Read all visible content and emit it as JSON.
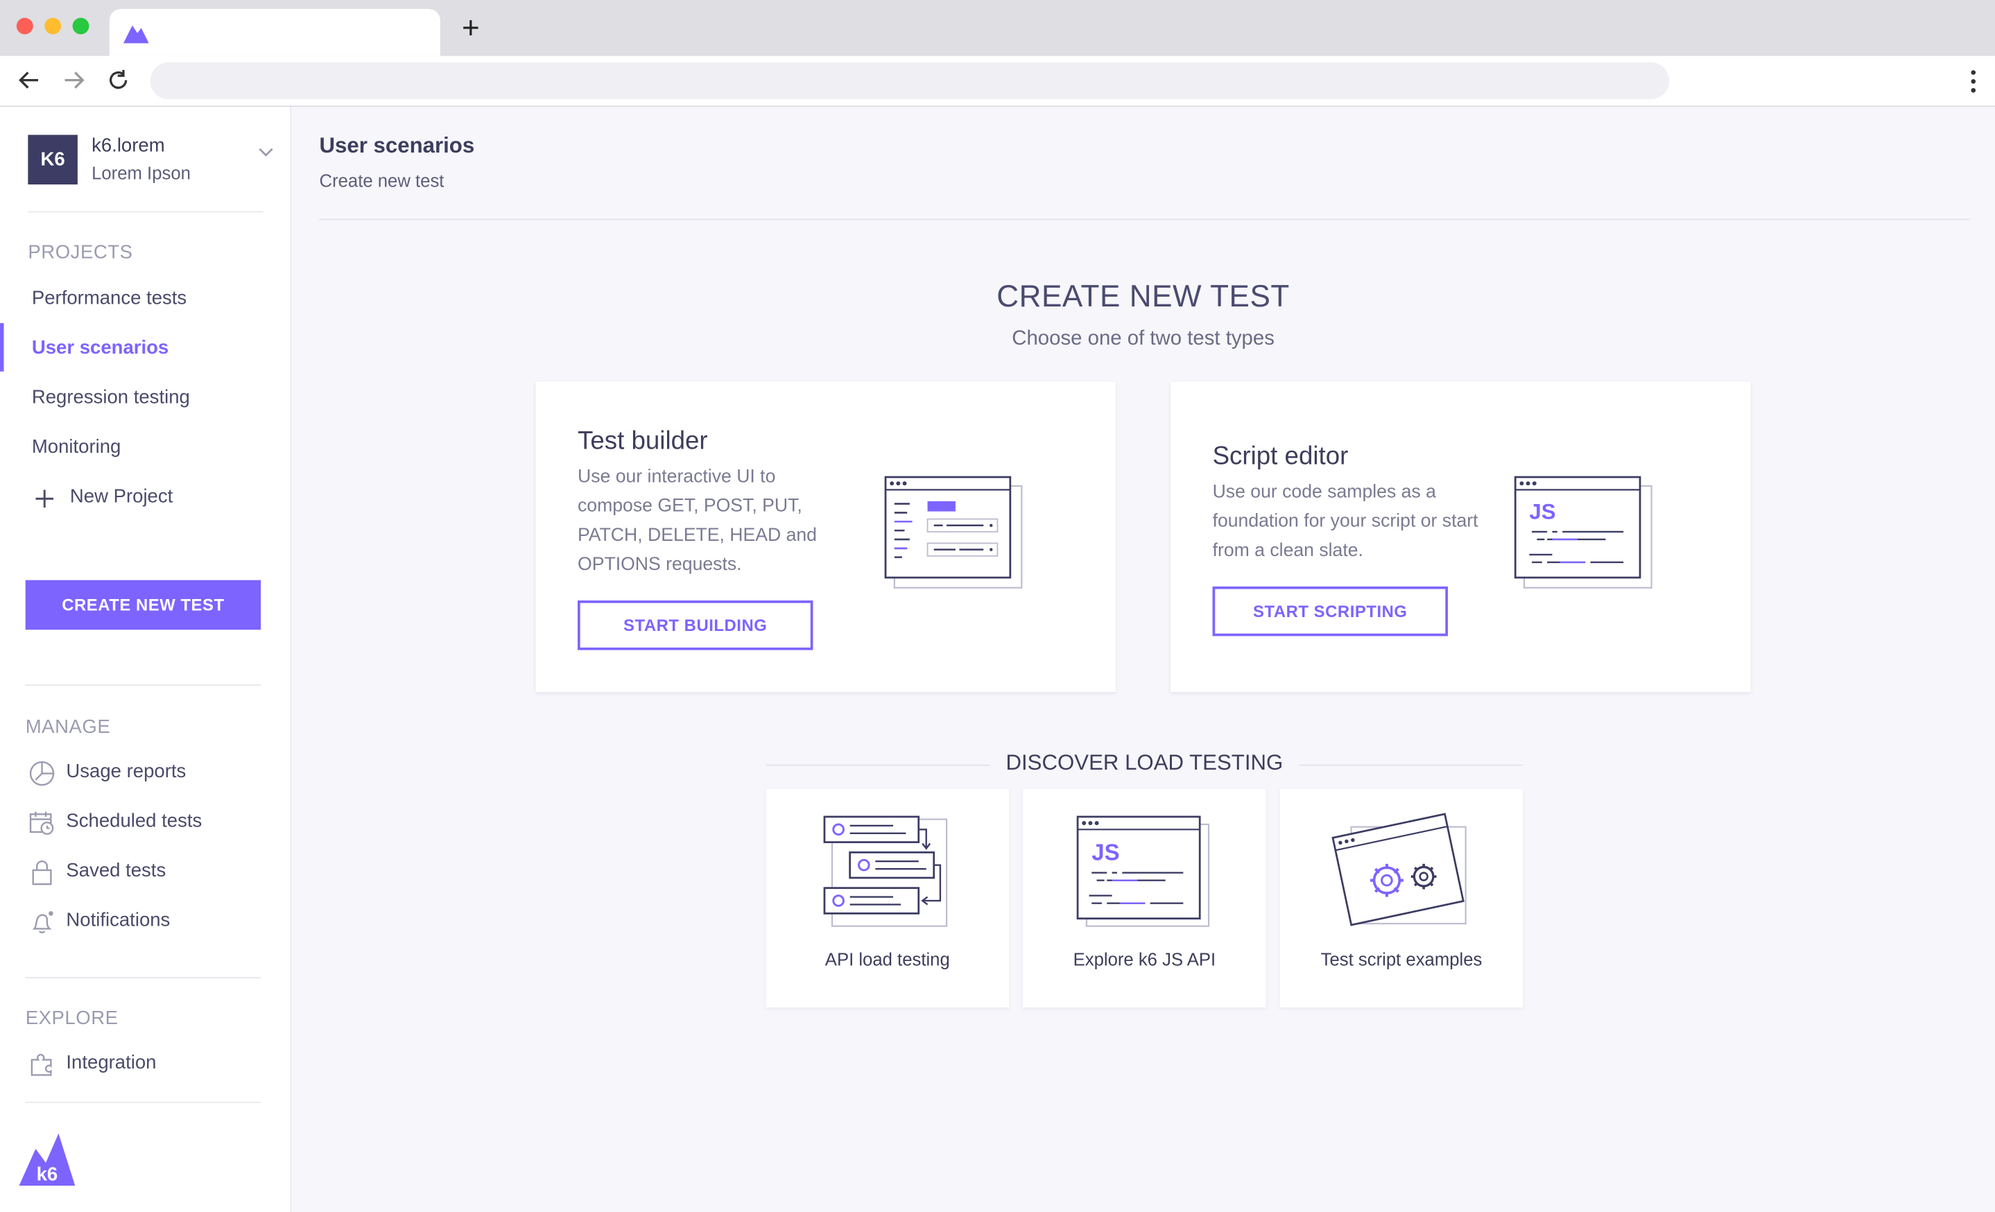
{
  "browser": {
    "tab_icon": "k6-logo-icon",
    "new_tab": "+",
    "icons": [
      "back-arrow-icon",
      "forward-arrow-icon",
      "reload-icon",
      "more-vert-icon"
    ]
  },
  "sidebar": {
    "org": {
      "badge": "K6",
      "name": "k6.lorem",
      "subtitle": "Lorem Ipson"
    },
    "projects_label": "PROJECTS",
    "projects": [
      {
        "label": "Performance tests"
      },
      {
        "label": "User scenarios",
        "active": true
      },
      {
        "label": "Regression testing"
      },
      {
        "label": "Monitoring"
      }
    ],
    "new_project": "New Project",
    "create_button": "CREATE NEW TEST",
    "manage_label": "MANAGE",
    "manage": [
      {
        "label": "Usage reports",
        "icon": "chart-icon"
      },
      {
        "label": "Scheduled tests",
        "icon": "calendar-icon"
      },
      {
        "label": "Saved tests",
        "icon": "lock-icon"
      },
      {
        "label": "Notifications",
        "icon": "bell-icon"
      }
    ],
    "explore_label": "EXPLORE",
    "explore": [
      {
        "label": "Integration",
        "icon": "puzzle-icon"
      }
    ],
    "logo_text": "k6"
  },
  "main": {
    "breadcrumb_title": "User scenarios",
    "breadcrumb_sub": "Create new test",
    "hero_title": "CREATE NEW TEST",
    "hero_sub": "Choose one of two test types",
    "cards": [
      {
        "title": "Test builder",
        "description": "Use our interactive UI to compose GET, POST, PUT, PATCH, DELETE, HEAD and OPTIONS requests.",
        "button": "START BUILDING"
      },
      {
        "title": "Script editor",
        "description": "Use our code samples as a foundation for your script or start from a clean slate.",
        "button": "START SCRIPTING",
        "illustration_text": "JS"
      }
    ],
    "discover_title": "DISCOVER LOAD TESTING",
    "tiles": [
      {
        "label": "API load testing"
      },
      {
        "label": "Explore k6 JS API",
        "illustration_text": "JS"
      },
      {
        "label": "Test script examples"
      }
    ]
  },
  "colors": {
    "accent": "#7d64ff",
    "navy": "#3c3c64",
    "background": "#f6f6fb"
  }
}
